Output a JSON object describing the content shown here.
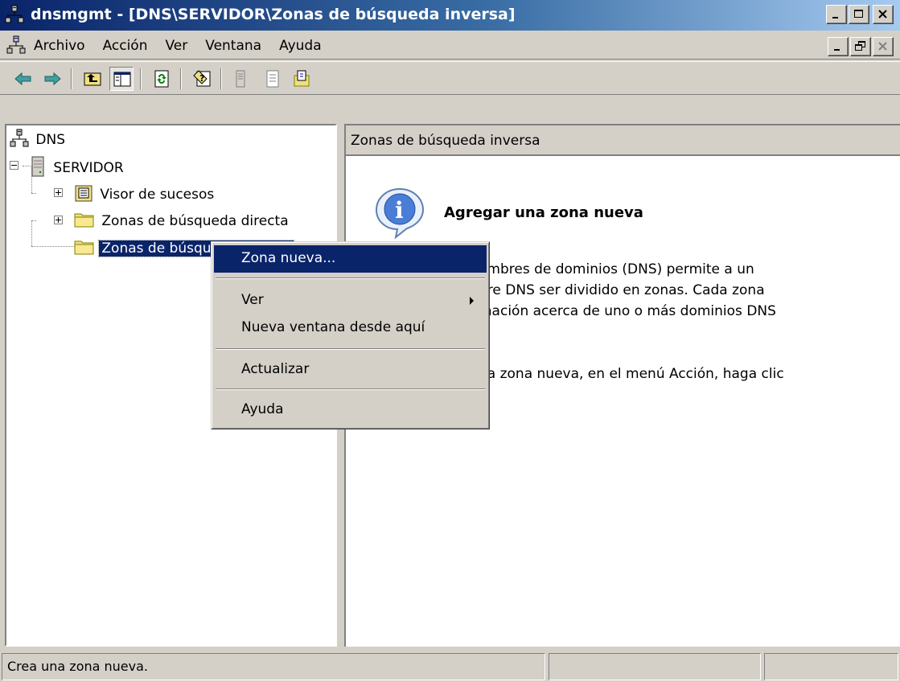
{
  "window": {
    "title": "dnsmgmt - [DNS\\SERVIDOR\\Zonas de búsqueda inversa]"
  },
  "menubar": {
    "items": [
      {
        "label": "Archivo"
      },
      {
        "label": "Acción"
      },
      {
        "label": "Ver"
      },
      {
        "label": "Ventana"
      },
      {
        "label": "Ayuda"
      }
    ]
  },
  "toolbar": {
    "icons": [
      "back-arrow-icon",
      "forward-arrow-icon",
      "up-folder-icon",
      "show-hide-tree-icon",
      "refresh-icon",
      "help-icon",
      "server-icon",
      "properties-icon",
      "export-icon"
    ]
  },
  "tree": {
    "root": {
      "label": "DNS",
      "icon": "dns-network-icon"
    },
    "server": {
      "label": "SERVIDOR",
      "icon": "server-icon"
    },
    "children": [
      {
        "label": "Visor de sucesos",
        "icon": "event-viewer-icon"
      },
      {
        "label": "Zonas de búsqueda directa",
        "icon": "folder-icon"
      },
      {
        "label": "Zonas de búsqueda inversa",
        "icon": "folder-icon",
        "selected": true
      }
    ]
  },
  "right_pane": {
    "header": "Zonas de búsqueda inversa",
    "info_title": "Agregar una zona nueva",
    "lines_p1": [
      "ombres de dominios (DNS) permite a un",
      "bre DNS ser dividido en zonas. Cada zona",
      "mación acerca de uno o más dominios DNS"
    ],
    "lines_p2": [
      "na zona nueva, en el menú Acción, haga clic",
      "."
    ]
  },
  "context_menu": {
    "items": [
      {
        "label": "Zona nueva...",
        "highlighted": true
      },
      {
        "label": "Ver",
        "submenu": true
      },
      {
        "label": "Nueva ventana desde aquí"
      },
      {
        "label": "Actualizar"
      },
      {
        "label": "Ayuda"
      }
    ]
  },
  "statusbar": {
    "text": "Crea una zona nueva."
  },
  "colors": {
    "title_gradient_start": "#0a246a",
    "title_gradient_end": "#a6caf0",
    "face": "#d4d0c8",
    "highlight": "#0a246a"
  }
}
